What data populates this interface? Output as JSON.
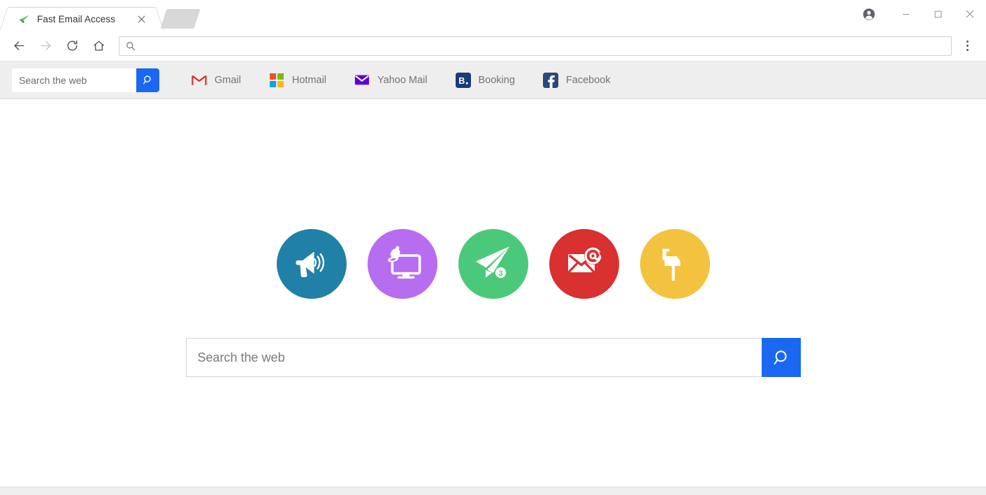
{
  "window": {
    "profile_icon": "account-circle-icon",
    "minimize_label": "–",
    "maximize_label": "□",
    "close_label": "✕"
  },
  "tabs": [
    {
      "title": "Fast Email Access",
      "favicon": "paper-plane-favicon",
      "close_label": "✕",
      "active": true
    }
  ],
  "toolbar": {
    "back_icon": "arrow-left-icon",
    "forward_icon": "arrow-right-icon",
    "reload_icon": "reload-icon",
    "home_icon": "home-icon",
    "omnibox": {
      "icon": "search-icon",
      "value": "",
      "placeholder": ""
    },
    "menu_icon": "three-dots-vertical-icon"
  },
  "extension_bar": {
    "search": {
      "value": "",
      "placeholder": "Search the web",
      "button_icon": "search-icon",
      "button_color": "#1967f2"
    },
    "bookmarks": [
      {
        "label": "Gmail",
        "icon": "gmail-icon",
        "color": "#d93025"
      },
      {
        "label": "Hotmail",
        "icon": "microsoft-icon",
        "color": "#f25022"
      },
      {
        "label": "Yahoo Mail",
        "icon": "yahoo-mail-envelope-icon",
        "color": "#5f01d1"
      },
      {
        "label": "Booking",
        "icon": "booking-icon",
        "color": "#1a3b79"
      },
      {
        "label": "Facebook",
        "icon": "facebook-icon",
        "color": "#29487d"
      }
    ]
  },
  "page": {
    "shortcuts": [
      {
        "name": "megaphone",
        "icon": "megaphone-icon",
        "color": "#2180a8",
        "badge": ""
      },
      {
        "name": "monitor-notification",
        "icon": "monitor-bell-icon",
        "color": "#b76df0",
        "badge": ""
      },
      {
        "name": "send-mail",
        "icon": "paper-plane-icon",
        "color": "#4bc97a",
        "badge": "3"
      },
      {
        "name": "email-at",
        "icon": "envelope-at-icon",
        "color": "#d93030",
        "badge": ""
      },
      {
        "name": "mailbox",
        "icon": "mailbox-icon",
        "color": "#f3c23f",
        "badge": ""
      }
    ],
    "search": {
      "value": "",
      "placeholder": "Search the web",
      "button_icon": "search-icon",
      "button_color": "#1a68f2"
    }
  }
}
